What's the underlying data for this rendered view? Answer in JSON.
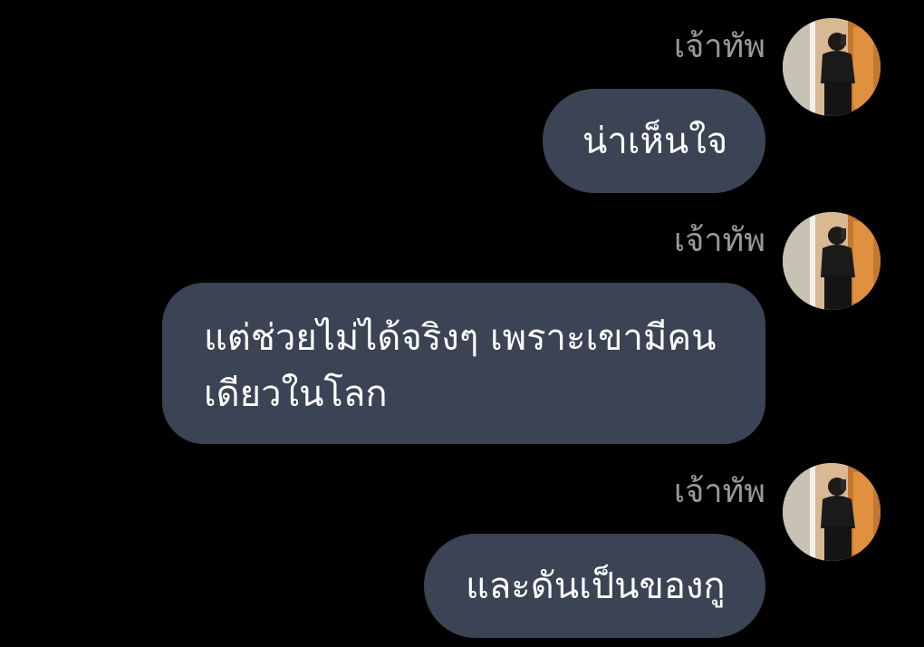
{
  "messages": [
    {
      "sender": "เจ้าทัพ",
      "text": "น่าเห็นใจ"
    },
    {
      "sender": "เจ้าทัพ",
      "text": "แต่ช่วยไม่ได้จริงๆ เพราะเขามีคน เดียวในโลก"
    },
    {
      "sender": "เจ้าทัพ",
      "text": "และดันเป็นของกู"
    }
  ],
  "colors": {
    "background": "#000000",
    "bubble": "#3b4354",
    "sender_name": "#9a9a9a",
    "message_text": "#ffffff"
  },
  "icons": {
    "avatar": "profile-photo-mirror-selfie"
  }
}
